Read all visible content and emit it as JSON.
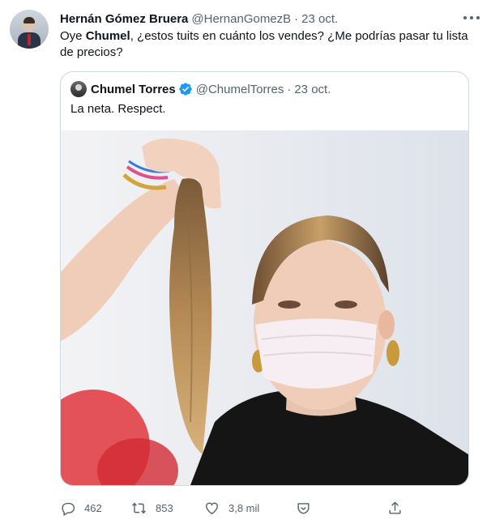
{
  "tweet": {
    "author_name": "Hernán Gómez Bruera",
    "author_handle": "@HernanGomezB",
    "separator": "·",
    "time": "23 oct.",
    "text_part1": "Oye ",
    "text_bold": "Chumel",
    "text_part2": ", ¿estos tuits en cuánto los vendes? ¿Me podrías pasar tu lista de precios?"
  },
  "quoted": {
    "author_name": "Chumel Torres",
    "author_handle": "@ChumelTorres",
    "separator": "·",
    "time": "23 oct.",
    "text": "La neta. Respect.",
    "verified": true
  },
  "actions": {
    "replies": "462",
    "retweets": "853",
    "likes": "3,8 mil"
  },
  "colors": {
    "text_primary": "#0f1419",
    "text_secondary": "#536471",
    "border": "#cfd9de",
    "verified_blue": "#1d9bf0"
  },
  "icons": [
    "more-icon",
    "verified-icon",
    "reply-icon",
    "retweet-icon",
    "like-icon",
    "react-icon",
    "share-icon"
  ]
}
